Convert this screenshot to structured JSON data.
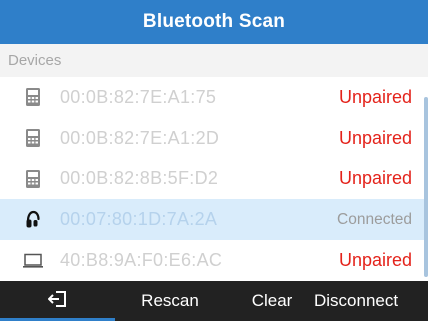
{
  "title": "Bluetooth Scan",
  "section": {
    "label": "Devices"
  },
  "devices": [
    {
      "mac": "00:0B:82:7E:A1:75",
      "status": "Unpaired",
      "icon": "phone-icon",
      "connected": false
    },
    {
      "mac": "00:0B:82:7E:A1:2D",
      "status": "Unpaired",
      "icon": "phone-icon",
      "connected": false
    },
    {
      "mac": "00:0B:82:8B:5F:D2",
      "status": "Unpaired",
      "icon": "phone-icon",
      "connected": false
    },
    {
      "mac": "00:07:80:1D:7A:2A",
      "status": "Connected",
      "icon": "headset-icon",
      "connected": true
    },
    {
      "mac": "40:B8:9A:F0:E6:AC",
      "status": "Unpaired",
      "icon": "computer-icon",
      "connected": false
    }
  ],
  "softkeys": {
    "back_icon": "back-icon",
    "rescan": "Rescan",
    "clear": "Clear",
    "disconnect": "Disconnect"
  },
  "colors": {
    "titlebar": "#2f7fc9",
    "unpaired": "#e4231b",
    "connected_row": "#d9ecfb",
    "softkey_bar": "#222222"
  }
}
